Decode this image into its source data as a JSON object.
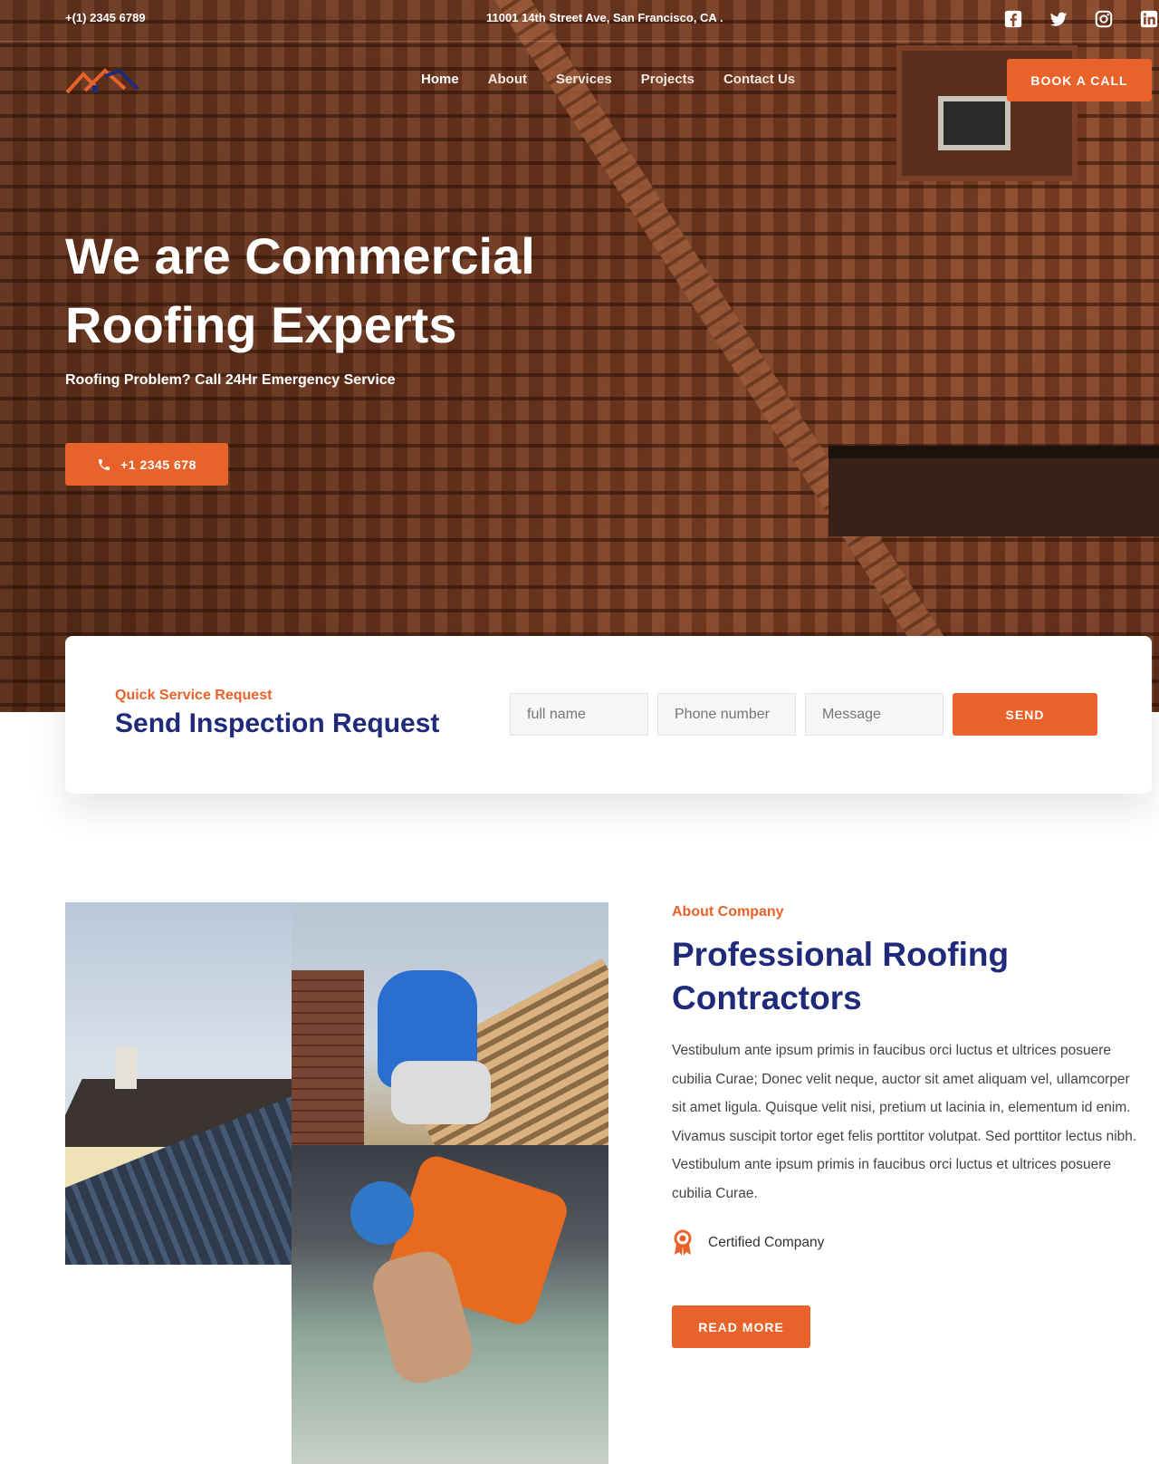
{
  "topbar": {
    "phone": "+(1) 2345 6789",
    "address": "11001 14th Street Ave, San Francisco, CA .",
    "socials": [
      "facebook-icon",
      "twitter-icon",
      "instagram-icon",
      "linkedin-icon"
    ]
  },
  "nav": {
    "items": [
      {
        "label": "Home",
        "active": true
      },
      {
        "label": "About",
        "active": false
      },
      {
        "label": "Services",
        "active": false
      },
      {
        "label": "Projects",
        "active": false
      },
      {
        "label": "Contact Us",
        "active": false
      }
    ],
    "cta": "BOOK A CALL"
  },
  "hero": {
    "title_line1": "We are Commercial",
    "title_line2": "Roofing Experts",
    "subtitle": "Roofing Problem? Call 24Hr Emergency Service",
    "call_label": "+1 2345 678"
  },
  "inspection": {
    "eyebrow": "Quick Service Request",
    "title": "Send Inspection Request",
    "name_placeholder": "full name",
    "phone_placeholder": "Phone number",
    "message_placeholder": "Message",
    "send_label": "SEND"
  },
  "about": {
    "eyebrow": "About Company",
    "title_line1": "Professional Roofing",
    "title_line2": "Contractors",
    "body": "Vestibulum ante ipsum primis in faucibus orci luctus et ultrices posuere cubilia Curae; Donec velit neque, auctor sit amet aliquam vel, ullamcorper sit amet ligula. Quisque velit nisi, pretium ut lacinia in, elementum id enim. Vivamus suscipit tortor eget felis porttitor volutpat. Sed porttitor lectus nibh. Vestibulum ante ipsum primis in faucibus orci luctus et ultrices posuere cubilia Curae.",
    "certified_label": "Certified Company",
    "read_more": "READ MORE"
  },
  "colors": {
    "accent": "#e8622a",
    "heading": "#1f2a7a"
  }
}
